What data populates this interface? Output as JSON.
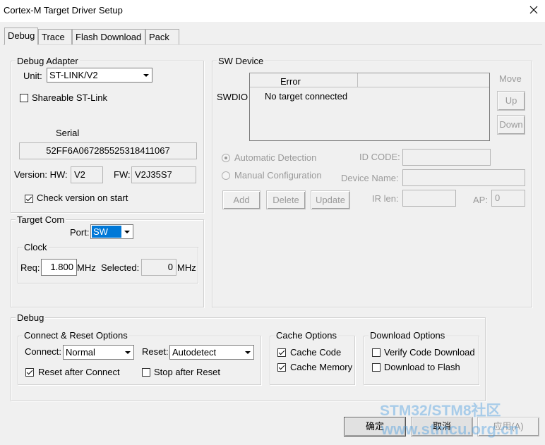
{
  "window": {
    "title": "Cortex-M Target Driver Setup",
    "close_glyph": "✕"
  },
  "tabs": [
    {
      "label": "Debug",
      "active": true
    },
    {
      "label": "Trace",
      "active": false
    },
    {
      "label": "Flash Download",
      "active": false
    },
    {
      "label": "Pack",
      "active": false
    }
  ],
  "debug_adapter": {
    "legend": "Debug Adapter",
    "unit_label": "Unit:",
    "unit_value": "ST-LINK/V2",
    "shareable_label": "Shareable ST-Link",
    "shareable_checked": false,
    "serial_label": "Serial",
    "serial_value": "52FF6A067285525318411067",
    "version_hw_label": "Version: HW:",
    "hw_value": "V2",
    "fw_label": "FW:",
    "fw_value": "V2J35S7",
    "check_version_label": "Check version on start",
    "check_version_checked": true
  },
  "target_com": {
    "legend": "Target Com",
    "port_label": "Port:",
    "port_value": "SW",
    "clock_legend": "Clock",
    "req_label": "Req:",
    "req_value": "1.800",
    "req_unit": "MHz",
    "selected_label": "Selected:",
    "selected_value": "0",
    "selected_unit": "MHz"
  },
  "sw_device": {
    "legend": "SW Device",
    "row_label": "SWDIO",
    "col_header": "Error",
    "row_text": "No target connected",
    "move_label": "Move",
    "up_label": "Up",
    "down_label": "Down",
    "auto_detect_label": "Automatic Detection",
    "manual_config_label": "Manual Configuration",
    "id_code_label": "ID CODE:",
    "device_name_label": "Device Name:",
    "add_label": "Add",
    "delete_label": "Delete",
    "update_label": "Update",
    "ir_len_label": "IR len:",
    "ap_label": "AP:",
    "ap_value": "0"
  },
  "debug_section": {
    "legend": "Debug",
    "connect_reset_legend": "Connect & Reset Options",
    "connect_label": "Connect:",
    "connect_value": "Normal",
    "reset_label": "Reset:",
    "reset_value": "Autodetect",
    "reset_after_connect_label": "Reset after Connect",
    "reset_after_connect_checked": true,
    "stop_after_reset_label": "Stop after Reset",
    "stop_after_reset_checked": false,
    "cache_legend": "Cache Options",
    "cache_code_label": "Cache Code",
    "cache_code_checked": true,
    "cache_memory_label": "Cache Memory",
    "cache_memory_checked": true,
    "download_legend": "Download Options",
    "verify_code_label": "Verify Code Download",
    "verify_code_checked": false,
    "download_flash_label": "Download to Flash",
    "download_flash_checked": false
  },
  "footer": {
    "ok_label": "确定",
    "cancel_label": "取消",
    "apply_label": "应用(A)"
  },
  "watermark": {
    "line1": "STM32/STM8社区",
    "line2": "www.stmcu.org.cn"
  },
  "colors": {
    "dialog_bg": "#f0f0f0",
    "selection_blue": "#0078d7",
    "watermark": "#50a0e1"
  }
}
